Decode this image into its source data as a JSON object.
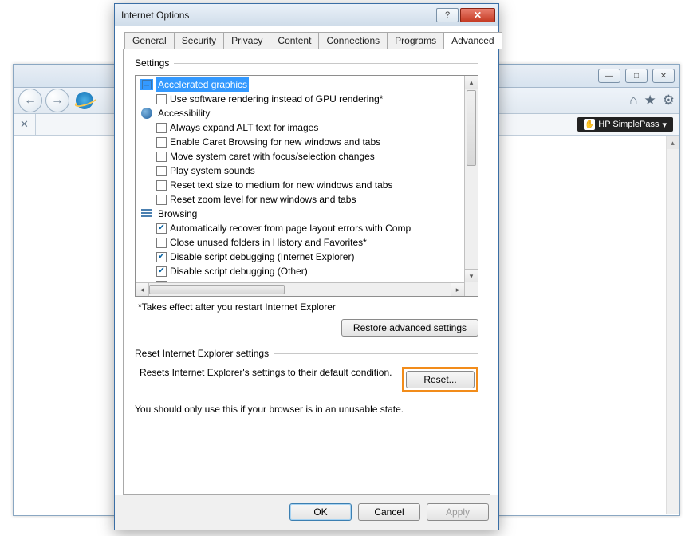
{
  "browser": {
    "simplepass_label": "HP SimplePass",
    "content_scrollable": true
  },
  "dialog": {
    "title": "Internet Options",
    "tabs": [
      "General",
      "Security",
      "Privacy",
      "Content",
      "Connections",
      "Programs",
      "Advanced"
    ],
    "active_tab": "Advanced",
    "settings_label": "Settings",
    "tree": {
      "categories": [
        {
          "icon": "minus",
          "label": "Accelerated graphics",
          "selected": true,
          "items": [
            {
              "checked": false,
              "label": "Use software rendering instead of GPU rendering*"
            }
          ]
        },
        {
          "icon": "globe",
          "label": "Accessibility",
          "items": [
            {
              "checked": false,
              "label": "Always expand ALT text for images"
            },
            {
              "checked": false,
              "label": "Enable Caret Browsing for new windows and tabs"
            },
            {
              "checked": false,
              "label": "Move system caret with focus/selection changes"
            },
            {
              "checked": false,
              "label": "Play system sounds"
            },
            {
              "checked": false,
              "label": "Reset text size to medium for new windows and tabs"
            },
            {
              "checked": false,
              "label": "Reset zoom level for new windows and tabs"
            }
          ]
        },
        {
          "icon": "list",
          "label": "Browsing",
          "items": [
            {
              "checked": true,
              "label": "Automatically recover from page layout errors with Comp"
            },
            {
              "checked": false,
              "label": "Close unused folders in History and Favorites*"
            },
            {
              "checked": true,
              "label": "Disable script debugging (Internet Explorer)"
            },
            {
              "checked": true,
              "label": "Disable script debugging (Other)"
            },
            {
              "checked": false,
              "label": "Display a notification about every script error"
            }
          ]
        }
      ]
    },
    "note": "*Takes effect after you restart Internet Explorer",
    "restore_btn": "Restore advanced settings",
    "reset_group_label": "Reset Internet Explorer settings",
    "reset_desc": "Resets Internet Explorer's settings to their default condition.",
    "reset_btn": "Reset...",
    "reset_warn": "You should only use this if your browser is in an unusable state.",
    "footer": {
      "ok": "OK",
      "cancel": "Cancel",
      "apply": "Apply"
    }
  }
}
